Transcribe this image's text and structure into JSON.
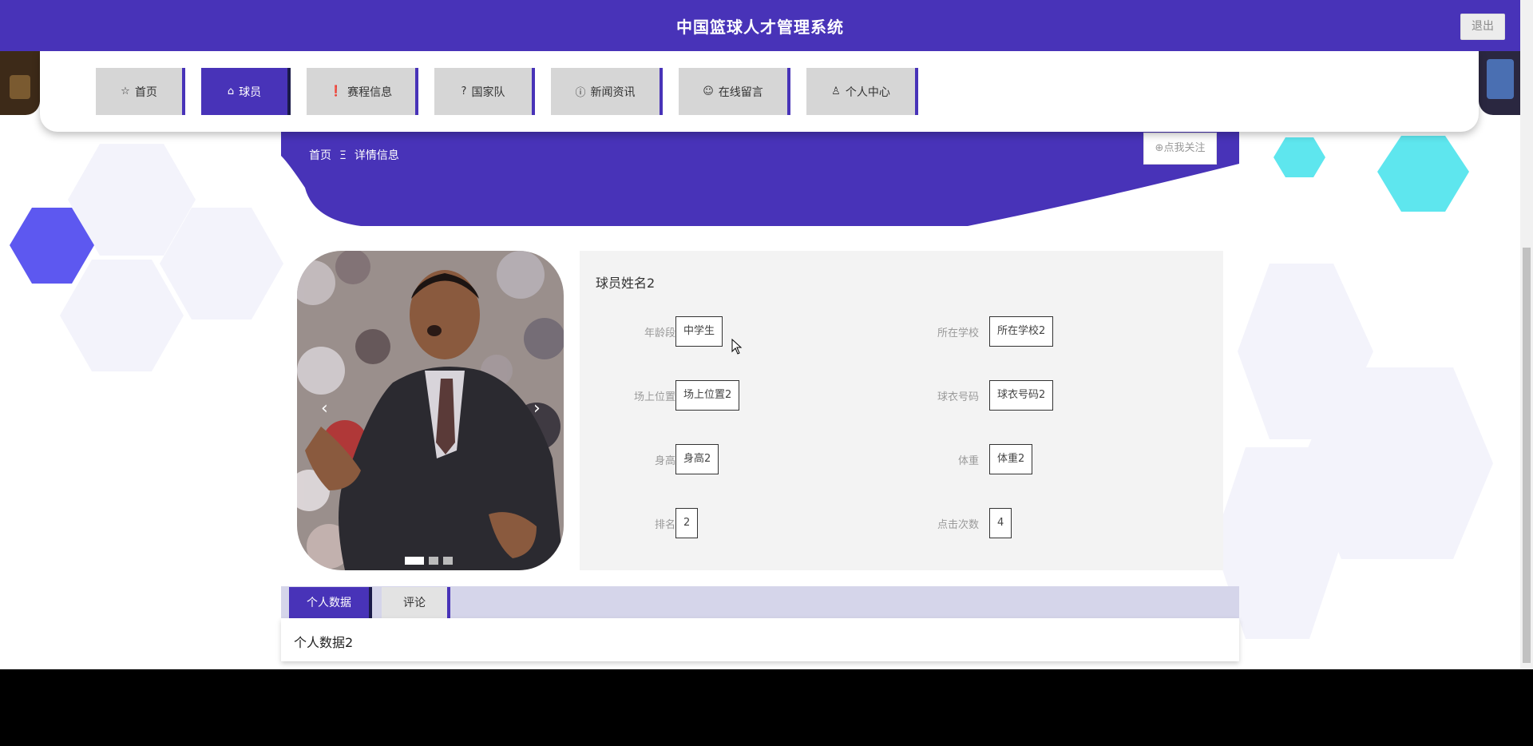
{
  "header": {
    "title": "中国篮球人才管理系统",
    "logout_label": "退出"
  },
  "nav": {
    "items": [
      {
        "label": "首页",
        "icon": "star-icon"
      },
      {
        "label": "球员",
        "icon": "lock-icon",
        "active": true
      },
      {
        "label": "赛程信息",
        "icon": "exclamation-circle-icon"
      },
      {
        "label": "国家队",
        "icon": "question-circle-icon"
      },
      {
        "label": "新闻资讯",
        "icon": "info-circle-icon"
      },
      {
        "label": "在线留言",
        "icon": "smile-icon"
      },
      {
        "label": "个人中心",
        "icon": "user-icon"
      }
    ]
  },
  "breadcrumb": {
    "home": "首页",
    "separator": "Ξ",
    "current": "详情信息"
  },
  "follow_label": "⊕点我关注",
  "carousel": {
    "prev": "‹",
    "next": "›",
    "slides": 3,
    "active": 0
  },
  "player": {
    "name": "球员姓名2",
    "fields": [
      {
        "label": "年龄段",
        "value": "中学生"
      },
      {
        "label": "所在学校",
        "value": "所在学校2"
      },
      {
        "label": "场上位置",
        "value": "场上位置2"
      },
      {
        "label": "球衣号码",
        "value": "球衣号码2"
      },
      {
        "label": "身高",
        "value": "身高2"
      },
      {
        "label": "体重",
        "value": "体重2"
      },
      {
        "label": "排名",
        "value": "2"
      },
      {
        "label": "点击次数",
        "value": "4"
      }
    ]
  },
  "tabs": {
    "items": [
      {
        "label": "个人数据",
        "active": true
      },
      {
        "label": "评论",
        "active": false
      }
    ],
    "content": "个人数据2"
  },
  "colors": {
    "primary": "#4833b8",
    "nav_inactive": "#d6d6d6",
    "panel": "#f3f3f3"
  }
}
